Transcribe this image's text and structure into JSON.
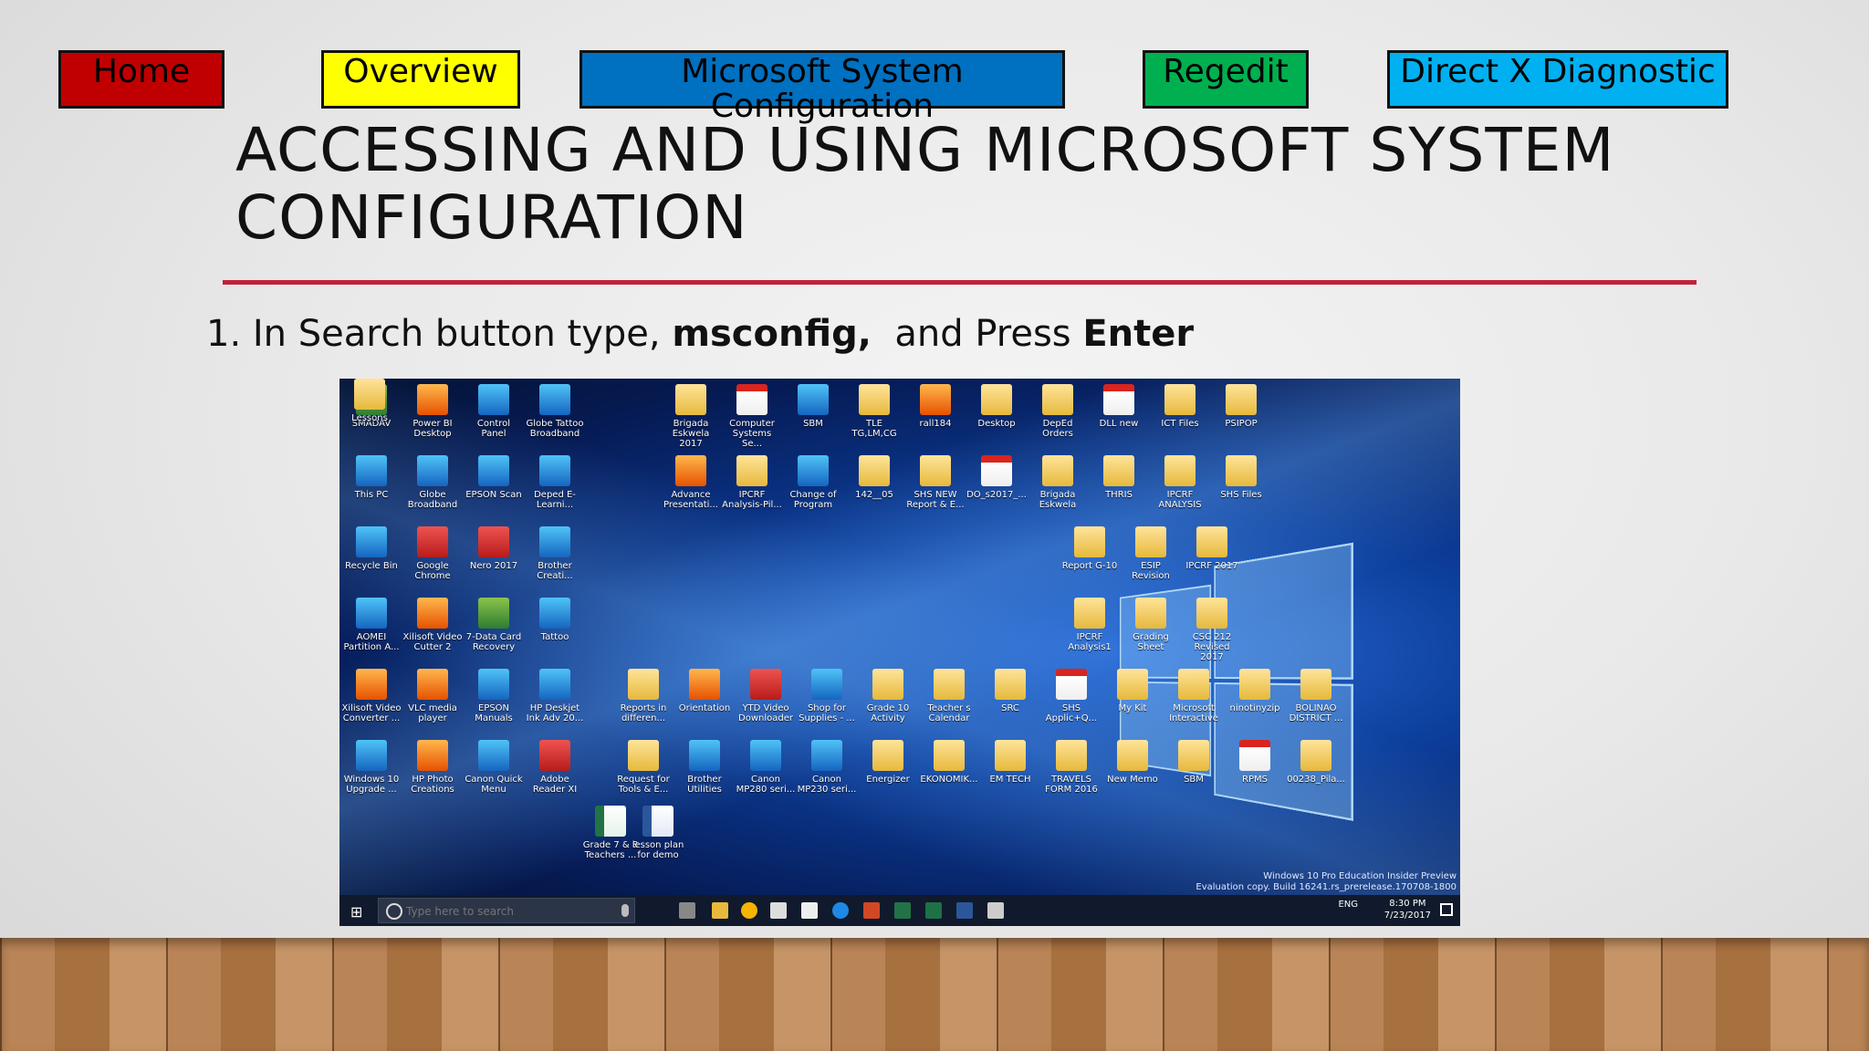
{
  "nav": {
    "home": "Home",
    "overview": "Overview",
    "msconfig": "Microsoft System Configuration",
    "regedit": "Regedit",
    "dxdiag": "Direct X Diagnostic"
  },
  "slide": {
    "title": "ACCESSING AND USING MICROSOFT SYSTEM CONFIGURATION",
    "step_prefix": "1. In Search button type, ",
    "step_cmd": "msconfig,",
    "step_mid": "  and Press ",
    "step_key": "Enter"
  },
  "desktop": {
    "icons": [
      {
        "label": "SMADAV",
        "kind": "green"
      },
      {
        "label": "Power BI Desktop",
        "kind": "orange"
      },
      {
        "label": "Control Panel",
        "kind": "app"
      },
      {
        "label": "Globe Tattoo Broadband",
        "kind": "app"
      },
      {
        "label": "This PC",
        "kind": "app"
      },
      {
        "label": "Globe Broadband",
        "kind": "app"
      },
      {
        "label": "EPSON Scan",
        "kind": "app"
      },
      {
        "label": "Deped E-Learni...",
        "kind": "app"
      },
      {
        "label": "Recycle Bin",
        "kind": "app"
      },
      {
        "label": "Google Chrome",
        "kind": "red"
      },
      {
        "label": "Nero 2017",
        "kind": "red"
      },
      {
        "label": "Brother Creati...",
        "kind": "app"
      },
      {
        "label": "AOMEI Partition A...",
        "kind": "app"
      },
      {
        "label": "Xilisoft Video Cutter 2",
        "kind": "orange"
      },
      {
        "label": "7-Data Card Recovery",
        "kind": "green"
      },
      {
        "label": "Tattoo",
        "kind": "app"
      },
      {
        "label": "Xilisoft Video Converter ...",
        "kind": "orange"
      },
      {
        "label": "VLC media player",
        "kind": "orange"
      },
      {
        "label": "EPSON Manuals",
        "kind": "app"
      },
      {
        "label": "HP Deskjet Ink Adv 20...",
        "kind": "app"
      },
      {
        "label": "Windows 10 Upgrade ...",
        "kind": "app"
      },
      {
        "label": "HP Photo Creations",
        "kind": "orange"
      },
      {
        "label": "Canon Quick Menu",
        "kind": "app"
      },
      {
        "label": "Adobe Reader XI",
        "kind": "red"
      },
      {
        "label": "Grade 7 & 8 Teachers ...",
        "kind": "excel"
      },
      {
        "label": "lesson plan for demo",
        "kind": "word"
      },
      {
        "label": "Brigada Eskwela 2017",
        "kind": "folder"
      },
      {
        "label": "Computer Systems Se...",
        "kind": "pdf"
      },
      {
        "label": "SBM",
        "kind": "app"
      },
      {
        "label": "TLE TG,LM,CG",
        "kind": "folder"
      },
      {
        "label": "rall184",
        "kind": "orange"
      },
      {
        "label": "Desktop",
        "kind": "folder"
      },
      {
        "label": "DepEd Orders",
        "kind": "folder"
      },
      {
        "label": "DLL new",
        "kind": "pdf"
      },
      {
        "label": "ICT Files",
        "kind": "folder"
      },
      {
        "label": "PSIPOP",
        "kind": "folder"
      },
      {
        "label": "Advance Presentati...",
        "kind": "orange"
      },
      {
        "label": "IPCRF Analysis-Pil...",
        "kind": "folder"
      },
      {
        "label": "Change of Program",
        "kind": "app"
      },
      {
        "label": "142__05",
        "kind": "folder"
      },
      {
        "label": "SHS NEW Report & E...",
        "kind": "folder"
      },
      {
        "label": "DO_s2017_...",
        "kind": "pdf"
      },
      {
        "label": "Brigada Eskwela",
        "kind": "folder"
      },
      {
        "label": "THRIS",
        "kind": "folder"
      },
      {
        "label": "IPCRF ANALYSIS",
        "kind": "folder"
      },
      {
        "label": "SHS Files",
        "kind": "folder"
      },
      {
        "label": "Report G-10",
        "kind": "folder"
      },
      {
        "label": "ESIP Revision",
        "kind": "folder"
      },
      {
        "label": "IPCRF 2017",
        "kind": "folder"
      },
      {
        "label": "IPCRF Analysis1",
        "kind": "folder"
      },
      {
        "label": "Grading Sheet",
        "kind": "folder"
      },
      {
        "label": "CSC 212 Revised 2017",
        "kind": "folder"
      },
      {
        "label": "Reports in differen...",
        "kind": "folder"
      },
      {
        "label": "Orientation",
        "kind": "orange"
      },
      {
        "label": "YTD Video Downloader",
        "kind": "red"
      },
      {
        "label": "Shop for Supplies - ...",
        "kind": "app"
      },
      {
        "label": "Grade 10 Activity",
        "kind": "folder"
      },
      {
        "label": "Teacher s Calendar",
        "kind": "folder"
      },
      {
        "label": "SRC",
        "kind": "folder"
      },
      {
        "label": "SHS Applic+Q...",
        "kind": "pdf"
      },
      {
        "label": "My Kit",
        "kind": "folder"
      },
      {
        "label": "Microsoft Interactive",
        "kind": "folder"
      },
      {
        "label": "ninotinyzip",
        "kind": "folder"
      },
      {
        "label": "BOLINAO DISTRICT ...",
        "kind": "folder"
      },
      {
        "label": "Request for Tools & E...",
        "kind": "folder"
      },
      {
        "label": "Brother Utilities",
        "kind": "app"
      },
      {
        "label": "Canon MP280 seri...",
        "kind": "app"
      },
      {
        "label": "Canon MP230 seri...",
        "kind": "app"
      },
      {
        "label": "Energizer",
        "kind": "folder"
      },
      {
        "label": "EKONOMIK...",
        "kind": "folder"
      },
      {
        "label": "EM TECH",
        "kind": "folder"
      },
      {
        "label": "TRAVELS FORM 2016",
        "kind": "folder"
      },
      {
        "label": "New Memo",
        "kind": "folder"
      },
      {
        "label": "SBM",
        "kind": "folder"
      },
      {
        "label": "RPMS",
        "kind": "pdf"
      },
      {
        "label": "00238_Pila...",
        "kind": "folder"
      },
      {
        "label": "Lessons",
        "kind": "folder"
      }
    ],
    "watermark_line1": "Windows 10 Pro Education Insider Preview",
    "watermark_line2": "Evaluation copy. Build 16241.rs_prerelease.170708-1800"
  },
  "taskbar": {
    "search_placeholder": "Type here to search",
    "lang": "ENG",
    "time": "8:30 PM",
    "date": "7/23/2017"
  },
  "colors": {
    "home": "#c00000",
    "overview": "#ffff00",
    "msconfig": "#0070c0",
    "regedit": "#00b050",
    "dxdiag": "#00b0f0",
    "rule": "#c0223b"
  }
}
